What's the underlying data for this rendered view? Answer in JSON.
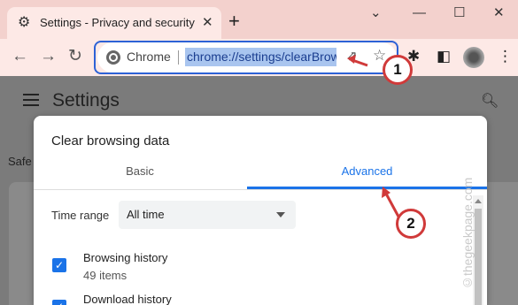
{
  "window": {
    "tab_title": "Settings - Privacy and security",
    "tab_icon": "gear-icon",
    "controls": [
      "minimize",
      "maximize",
      "close"
    ]
  },
  "toolbar": {
    "omnibox_chip": "Chrome",
    "url": "chrome://settings/clearBrowserData",
    "icons": [
      "back-arrow-icon",
      "forward-arrow-icon",
      "reload-icon",
      "share-icon",
      "star-icon",
      "extensions-icon",
      "sidepanel-icon",
      "profile-avatar",
      "menu-icon"
    ]
  },
  "page": {
    "title": "Settings",
    "section_partial": "Safe"
  },
  "dialog": {
    "title": "Clear browsing data",
    "tabs": [
      {
        "label": "Basic",
        "active": false
      },
      {
        "label": "Advanced",
        "active": true
      }
    ],
    "time_range_label": "Time range",
    "time_range_value": "All time",
    "items": [
      {
        "title": "Browsing history",
        "subtitle": "49 items",
        "checked": true
      },
      {
        "title": "Download history",
        "subtitle": "",
        "checked": true
      }
    ]
  },
  "annotations": {
    "badge1": "1",
    "badge2": "2",
    "accent_color": "#d03a3a"
  },
  "watermark": "©thegeekpage.com",
  "colors": {
    "accent_blue": "#1a73e8",
    "titlebar": "#f3d1cd",
    "tab_bg": "#fde9e6"
  }
}
